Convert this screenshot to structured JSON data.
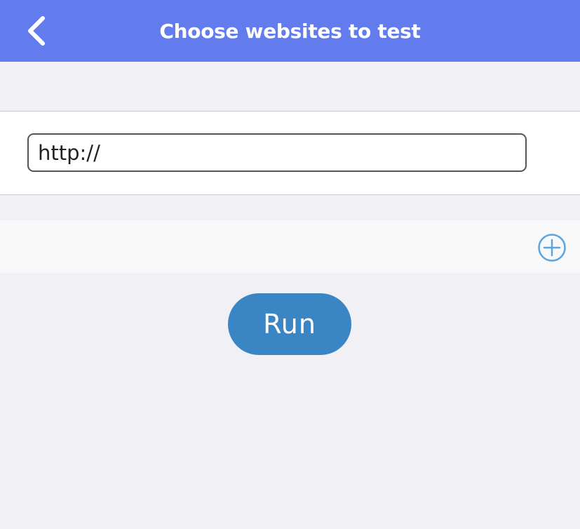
{
  "colors": {
    "header_bg": "#627cee",
    "page_bg": "#f0f0f5",
    "accent": "#3a86c5",
    "add_icon": "#5aa5e0"
  },
  "header": {
    "title": "Choose websites to test",
    "back_icon": "chevron-left-icon"
  },
  "url_form": {
    "value": "http://"
  },
  "add_row": {
    "icon": "plus-circle-icon"
  },
  "run_button": {
    "label": "Run"
  }
}
